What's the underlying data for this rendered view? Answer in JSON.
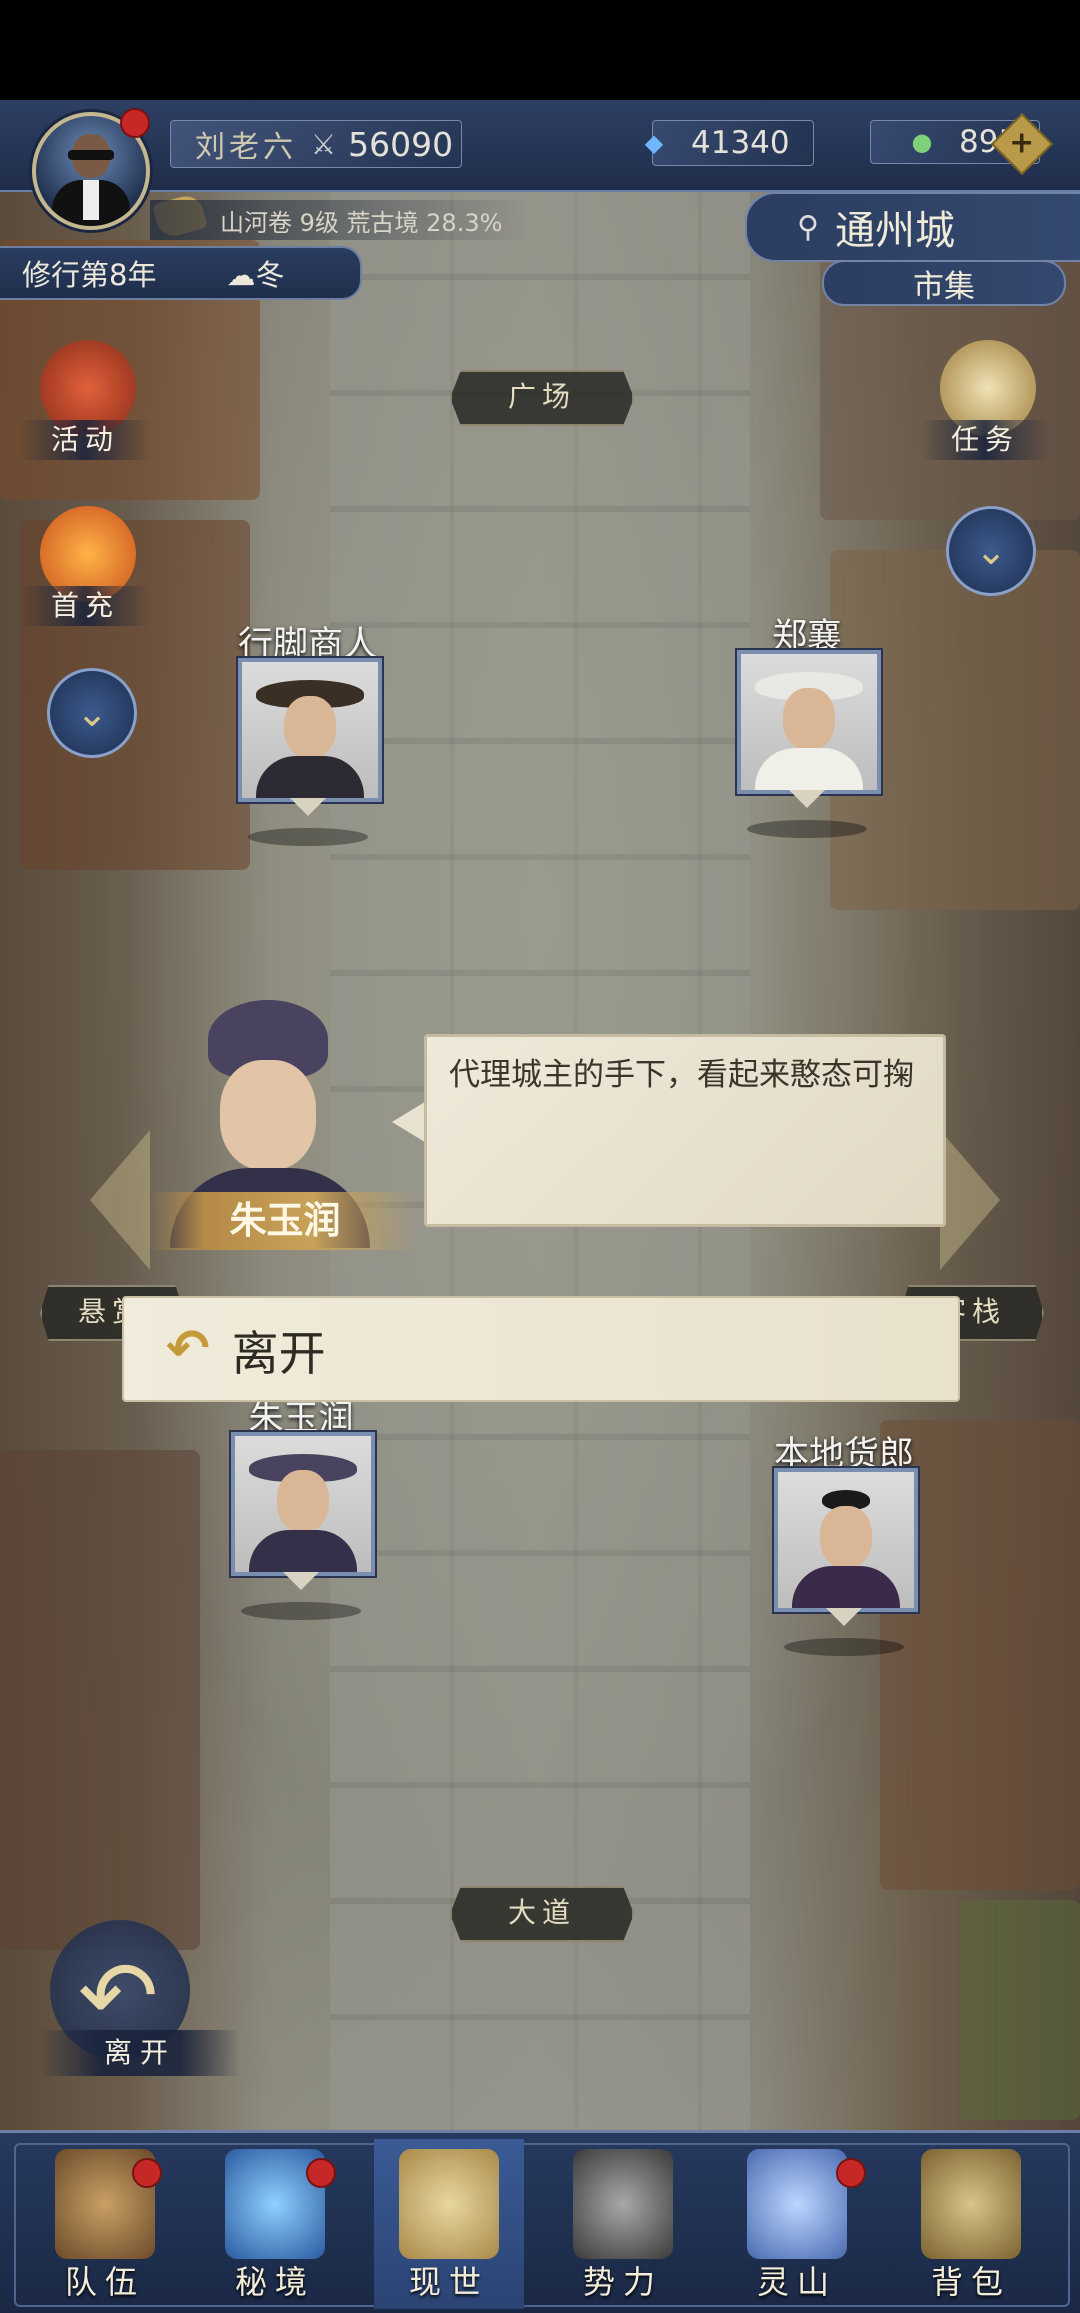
{
  "player": {
    "name": "刘老六",
    "power": "56090",
    "avatar_icon": "agent-avatar-icon"
  },
  "resources": {
    "crystal": "41340",
    "jade": "895"
  },
  "progress_line": "山河卷 9级 荒古境 28.3%",
  "cultivation": {
    "year": "修行第8年",
    "season": "冬"
  },
  "location": {
    "city": "通州城",
    "district": "市集"
  },
  "side_menu": {
    "activity": "活动",
    "first_recharge": "首充",
    "quest": "任务"
  },
  "places": {
    "north": "广场",
    "south": "大道",
    "west": "悬赏",
    "east": "客栈"
  },
  "npcs": [
    {
      "name": "行脚商人"
    },
    {
      "name": "郑襄"
    },
    {
      "name": "朱玉润"
    },
    {
      "name": "本地货郎"
    }
  ],
  "dialog": {
    "speaker": "朱玉润",
    "text": "代理城主的手下，看起来憨态可掬",
    "option": "离开"
  },
  "leave_button": "离开",
  "bottom_nav": [
    {
      "label": "队伍"
    },
    {
      "label": "秘境"
    },
    {
      "label": "现世"
    },
    {
      "label": "势力"
    },
    {
      "label": "灵山"
    },
    {
      "label": "背包"
    }
  ],
  "colors": {
    "accent_gold": "#c9a259",
    "nav_blue": "#263a5e",
    "notify_red": "#c62828"
  }
}
